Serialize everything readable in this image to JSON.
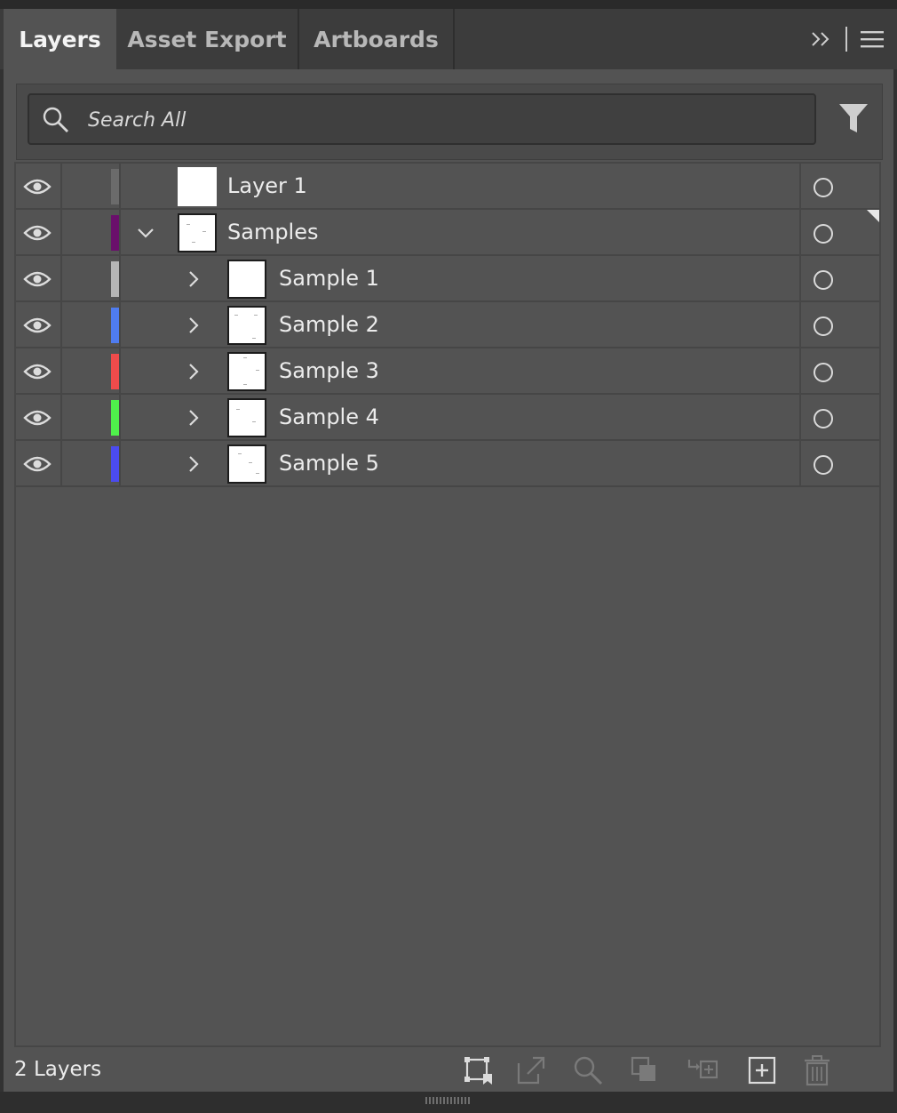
{
  "tabs": [
    {
      "label": "Layers",
      "active": true
    },
    {
      "label": "Asset Export",
      "active": false
    },
    {
      "label": "Artboards",
      "active": false
    }
  ],
  "tabs_actions": {
    "expand_icon": "double-chevron-right-icon",
    "menu_icon": "hamburger-menu-icon"
  },
  "search": {
    "placeholder": "Search All",
    "value": "",
    "icon": "search-icon",
    "filter_icon": "filter-icon"
  },
  "layers": [
    {
      "name": "Layer 1",
      "visible": true,
      "color": "#6b6b6b",
      "level": 0,
      "expanded": null
    },
    {
      "name": "Samples",
      "visible": true,
      "color": "#6a0f6b",
      "level": 0,
      "expanded": true
    },
    {
      "name": "Sample 1",
      "visible": true,
      "color": "#b5b5b5",
      "level": 1,
      "expanded": false
    },
    {
      "name": "Sample 2",
      "visible": true,
      "color": "#4f7cf0",
      "level": 1,
      "expanded": false
    },
    {
      "name": "Sample 3",
      "visible": true,
      "color": "#ef4b4b",
      "level": 1,
      "expanded": false
    },
    {
      "name": "Sample 4",
      "visible": true,
      "color": "#4ff04b",
      "level": 1,
      "expanded": false
    },
    {
      "name": "Sample 5",
      "visible": true,
      "color": "#4b4bf0",
      "level": 1,
      "expanded": false
    }
  ],
  "footer": {
    "layer_count": "2 Layers",
    "actions": [
      "collect-for-export-icon",
      "export-icon",
      "locate-object-icon",
      "make-clipping-mask-icon",
      "create-sublayer-icon",
      "create-new-layer-icon",
      "delete-icon"
    ]
  }
}
